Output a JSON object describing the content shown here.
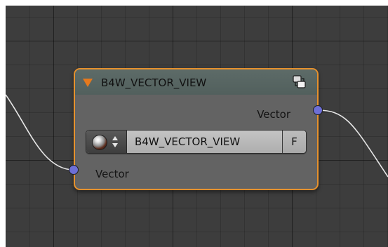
{
  "node": {
    "title": "B4W_VECTOR_VIEW",
    "output_label": "Vector",
    "input_label": "Vector",
    "material_name": "B4W_VECTOR_VIEW",
    "fake_user_label": "F"
  },
  "icons": {
    "collapse": "collapse-triangle-icon",
    "node_group": "node-group-icon",
    "material_preview": "material-sphere-icon",
    "browse_arrows": "up-down-arrows-icon"
  },
  "colors": {
    "node_border": "#e5912d",
    "node_body": "#636363",
    "header": "#5a6865",
    "socket_vector": "#6d6fd6",
    "link": "#e6e6e6",
    "canvas": "#3d3d3d"
  }
}
